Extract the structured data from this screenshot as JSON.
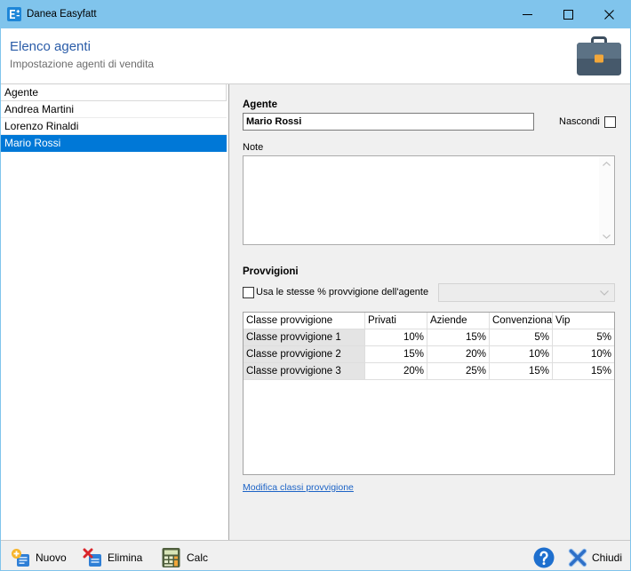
{
  "window": {
    "title": "Danea Easyfatt",
    "app_icon": "easyfatt-app-icon",
    "controls": {
      "minimize_icon": "minimize-icon",
      "maximize_icon": "maximize-icon",
      "close_icon": "close-icon"
    }
  },
  "header": {
    "title": "Elenco agenti",
    "subtitle": "Impostazione agenti di vendita",
    "icon": "briefcase-icon"
  },
  "agent_list": {
    "column_header": "Agente",
    "items": [
      {
        "name": "Andrea Martini",
        "selected": false
      },
      {
        "name": "Lorenzo Rinaldi",
        "selected": false
      },
      {
        "name": "Mario Rossi",
        "selected": true
      }
    ]
  },
  "detail": {
    "agent": {
      "label": "Agente",
      "value": "Mario Rossi"
    },
    "hide": {
      "label": "Nascondi",
      "checked": false
    },
    "notes": {
      "label": "Note",
      "value": ""
    },
    "commissions": {
      "label": "Provvigioni",
      "same_percent": {
        "label": "Usa le stesse % provvigione dell'agente",
        "checked": false,
        "select_value": "",
        "select_enabled": false
      },
      "table": {
        "columns": [
          "Classe provvigione",
          "Privati",
          "Aziende",
          "Convenziona",
          "Vip"
        ],
        "rows": [
          [
            "Classe provvigione 1",
            "10%",
            "15%",
            "5%",
            "5%"
          ],
          [
            "Classe provvigione 2",
            "15%",
            "20%",
            "10%",
            "10%"
          ],
          [
            "Classe provvigione 3",
            "20%",
            "25%",
            "15%",
            "15%"
          ]
        ]
      },
      "edit_classes_link": "Modifica classi provvigione"
    }
  },
  "toolbar": {
    "new": {
      "label": "Nuovo",
      "icon": "new-icon"
    },
    "delete": {
      "label": "Elimina",
      "icon": "delete-icon"
    },
    "calc": {
      "label": "Calc",
      "icon": "calculator-icon"
    },
    "help": {
      "icon": "help-icon"
    },
    "close": {
      "label": "Chiudi",
      "icon": "close-x-icon"
    }
  },
  "colors": {
    "title_bar": "#80c4ec",
    "selection": "#0078d7",
    "header_title": "#2a5ca8",
    "link": "#1c63c6"
  }
}
